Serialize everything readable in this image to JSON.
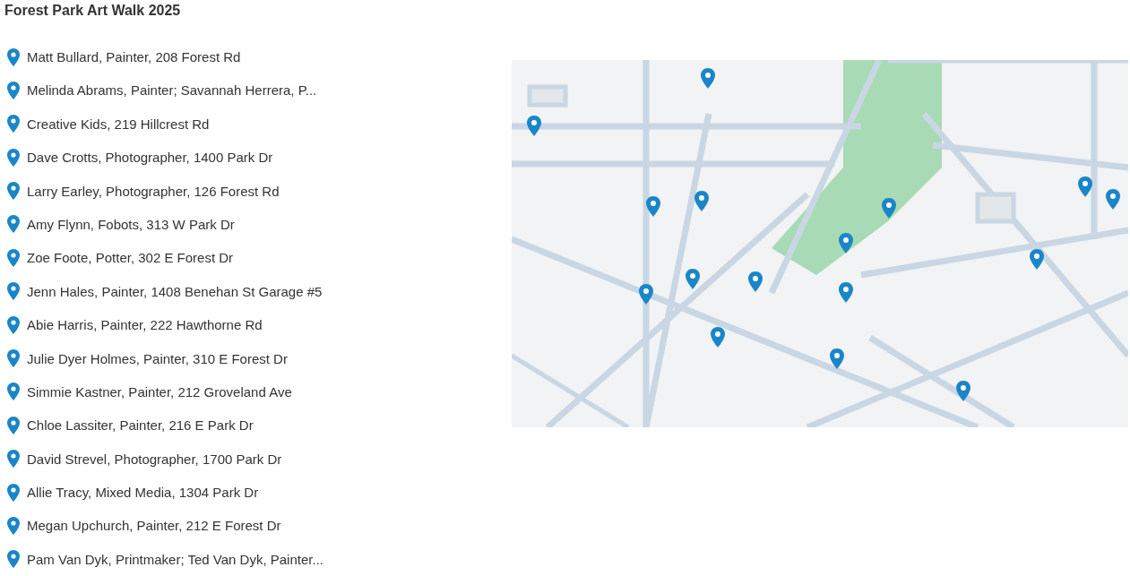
{
  "title": "Forest Park Art Walk 2025",
  "locations": [
    {
      "label": "Matt Bullard, Painter, 208 Forest Rd"
    },
    {
      "label": "Melinda Abrams, Painter; Savannah Herrera, P..."
    },
    {
      "label": "Creative Kids, 219 Hillcrest Rd"
    },
    {
      "label": "Dave Crotts, Photographer, 1400 Park Dr"
    },
    {
      "label": "Larry Earley, Photographer, 126 Forest Rd"
    },
    {
      "label": "Amy Flynn, Fobots, 313 W Park Dr"
    },
    {
      "label": "Zoe Foote, Potter,  302 E Forest Dr"
    },
    {
      "label": "Jenn Hales, Painter, 1408 Benehan St Garage #5"
    },
    {
      "label": "Abie Harris, Painter, 222 Hawthorne Rd"
    },
    {
      "label": "Julie Dyer Holmes, Painter,  310 E Forest Dr"
    },
    {
      "label": "Simmie Kastner, Painter, 212 Groveland Ave"
    },
    {
      "label": "Chloe Lassiter, Painter, 216 E Park Dr"
    },
    {
      "label": "David Strevel, Photographer, 1700 Park Dr"
    },
    {
      "label": "Allie Tracy, Mixed Media, 1304 Park Dr"
    },
    {
      "label": "Megan Upchurch, Painter, 212 E Forest Dr"
    },
    {
      "label": "Pam Van Dyk, Printmaker; Ted Van Dyk, Painter..."
    }
  ]
}
